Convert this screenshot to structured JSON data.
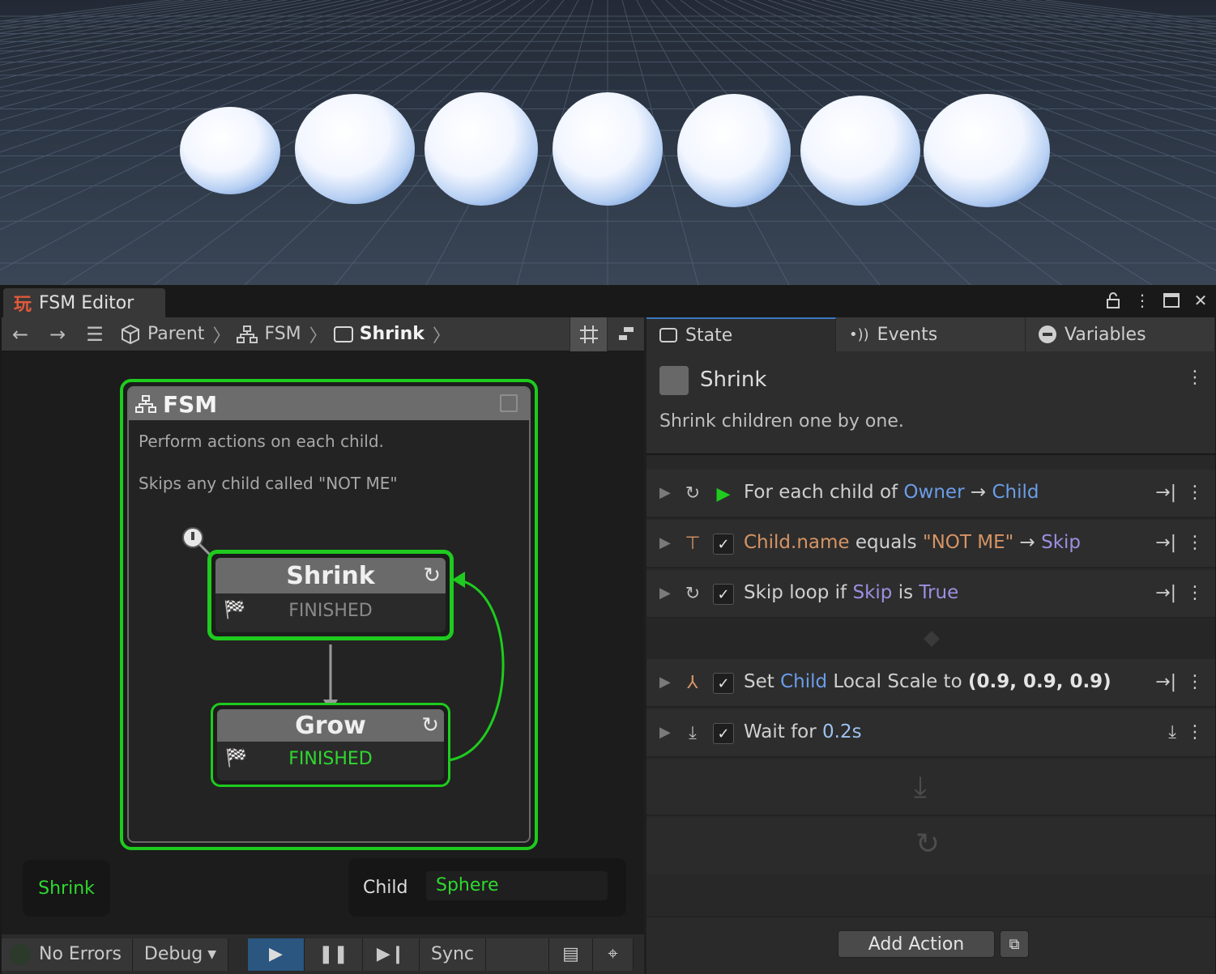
{
  "window": {
    "title": "FSM Editor",
    "logo_glyph": "玩"
  },
  "breadcrumb": {
    "items": [
      "Parent",
      "FSM",
      "Shrink"
    ]
  },
  "fsm": {
    "title": "FSM",
    "description_1": "Perform actions on each child.",
    "description_2": "Skips any child called \"NOT ME\"",
    "states": [
      {
        "name": "Shrink",
        "transition": "FINISHED",
        "active": true
      },
      {
        "name": "Grow",
        "transition": "FINISHED",
        "active": false
      }
    ]
  },
  "graph_footer": {
    "current_state": "Shrink",
    "variable_label": "Child",
    "variable_value": "Sphere"
  },
  "statusbar": {
    "errors": "No Errors",
    "debug": "Debug",
    "sync": "Sync"
  },
  "inspector": {
    "tabs": [
      "State",
      "Events",
      "Variables"
    ],
    "state_name": "Shrink",
    "state_description": "Shrink children one by one.",
    "actions": [
      {
        "parts": [
          "For each child of ",
          "Owner",
          " → ",
          "Child"
        ]
      },
      {
        "parts": [
          "Child.name",
          " equals ",
          "\"NOT ME\"",
          " → ",
          "Skip"
        ]
      },
      {
        "parts": [
          "Skip loop if ",
          "Skip",
          " is ",
          "True"
        ]
      },
      {
        "parts": [
          "Set ",
          "Child",
          " Local Scale to ",
          "(0.9, 0.9, 0.9)"
        ]
      },
      {
        "parts": [
          "Wait for ",
          "0.2s"
        ]
      }
    ],
    "add_action": "Add Action"
  },
  "colors": {
    "active_green": "#1ecb1e",
    "accent_blue": "#3a78c0",
    "var_blue": "#6b9de8",
    "bool_purple": "#9d8fe0",
    "string_orange": "#d69464"
  }
}
